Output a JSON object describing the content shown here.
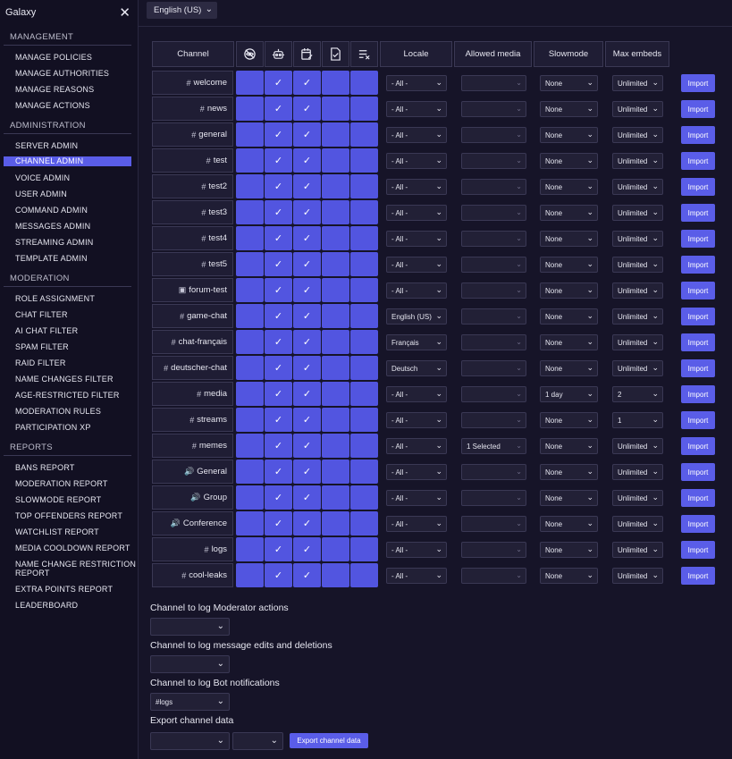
{
  "app": {
    "title": "Galaxy",
    "close_icon": "close-icon"
  },
  "language": {
    "selected": "English (US)"
  },
  "sidebar": {
    "sections": [
      {
        "title": "MANAGEMENT",
        "items": [
          "MANAGE POLICIES",
          "MANAGE AUTHORITIES",
          "MANAGE REASONS",
          "MANAGE ACTIONS"
        ]
      },
      {
        "title": "ADMINISTRATION",
        "items": [
          "SERVER ADMIN",
          "CHANNEL ADMIN",
          "VOICE ADMIN",
          "USER ADMIN",
          "COMMAND ADMIN",
          "MESSAGES ADMIN",
          "STREAMING ADMIN",
          "TEMPLATE ADMIN"
        ]
      },
      {
        "title": "MODERATION",
        "items": [
          "ROLE ASSIGNMENT",
          "CHAT FILTER",
          "AI CHAT FILTER",
          "SPAM FILTER",
          "RAID FILTER",
          "NAME CHANGES FILTER",
          "AGE-RESTRICTED FILTER",
          "MODERATION RULES",
          "PARTICIPATION XP"
        ]
      },
      {
        "title": "REPORTS",
        "items": [
          "BANS REPORT",
          "MODERATION REPORT",
          "SLOWMODE REPORT",
          "TOP OFFENDERS REPORT",
          "WATCHLIST REPORT",
          "MEDIA COOLDOWN REPORT",
          "NAME CHANGE RESTRICTION REPORT",
          "EXTRA POINTS REPORT",
          "LEADERBOARD"
        ]
      }
    ],
    "active": "CHANNEL ADMIN"
  },
  "table": {
    "headers": {
      "channel": "Channel",
      "icons": [
        "eye-slash-icon",
        "bot-icon",
        "calendar-edit-icon",
        "document-check-icon",
        "list-remove-icon"
      ],
      "locale": "Locale",
      "allowed_media": "Allowed media",
      "slowmode": "Slowmode",
      "max_embeds": "Max embeds"
    },
    "import_label": "Import",
    "rows": [
      {
        "icon": "#",
        "name": "welcome",
        "checks": [
          false,
          true,
          true,
          false,
          false
        ],
        "locale": "- All -",
        "media": "",
        "slowmode": "None",
        "max_embeds": "Unlimited"
      },
      {
        "icon": "#",
        "name": "news",
        "checks": [
          false,
          true,
          true,
          false,
          false
        ],
        "locale": "- All -",
        "media": "",
        "slowmode": "None",
        "max_embeds": "Unlimited"
      },
      {
        "icon": "#",
        "name": "general",
        "checks": [
          false,
          true,
          true,
          false,
          false
        ],
        "locale": "- All -",
        "media": "",
        "slowmode": "None",
        "max_embeds": "Unlimited"
      },
      {
        "icon": "#",
        "name": "test",
        "checks": [
          false,
          true,
          true,
          false,
          false
        ],
        "locale": "- All -",
        "media": "",
        "slowmode": "None",
        "max_embeds": "Unlimited"
      },
      {
        "icon": "#",
        "name": "test2",
        "checks": [
          false,
          true,
          true,
          false,
          false
        ],
        "locale": "- All -",
        "media": "",
        "slowmode": "None",
        "max_embeds": "Unlimited"
      },
      {
        "icon": "#",
        "name": "test3",
        "checks": [
          false,
          true,
          true,
          false,
          false
        ],
        "locale": "- All -",
        "media": "",
        "slowmode": "None",
        "max_embeds": "Unlimited"
      },
      {
        "icon": "#",
        "name": "test4",
        "checks": [
          false,
          true,
          true,
          false,
          false
        ],
        "locale": "- All -",
        "media": "",
        "slowmode": "None",
        "max_embeds": "Unlimited"
      },
      {
        "icon": "#",
        "name": "test5",
        "checks": [
          false,
          true,
          true,
          false,
          false
        ],
        "locale": "- All -",
        "media": "",
        "slowmode": "None",
        "max_embeds": "Unlimited"
      },
      {
        "icon": "▣",
        "name": "forum-test",
        "checks": [
          false,
          true,
          true,
          false,
          false
        ],
        "locale": "- All -",
        "media": "",
        "slowmode": "None",
        "max_embeds": "Unlimited"
      },
      {
        "icon": "#",
        "name": "game-chat",
        "checks": [
          false,
          true,
          true,
          false,
          false
        ],
        "locale": "English (US)",
        "media": "",
        "slowmode": "None",
        "max_embeds": "Unlimited"
      },
      {
        "icon": "#",
        "name": "chat-français",
        "checks": [
          false,
          true,
          true,
          false,
          false
        ],
        "locale": "Français",
        "media": "",
        "slowmode": "None",
        "max_embeds": "Unlimited"
      },
      {
        "icon": "#",
        "name": "deutscher-chat",
        "checks": [
          false,
          true,
          true,
          false,
          false
        ],
        "locale": "Deutsch",
        "media": "",
        "slowmode": "None",
        "max_embeds": "Unlimited"
      },
      {
        "icon": "#",
        "name": "media",
        "checks": [
          false,
          true,
          true,
          false,
          false
        ],
        "locale": "- All -",
        "media": "",
        "slowmode": "1 day",
        "max_embeds": "2"
      },
      {
        "icon": "#",
        "name": "streams",
        "checks": [
          false,
          true,
          true,
          false,
          false
        ],
        "locale": "- All -",
        "media": "",
        "slowmode": "None",
        "max_embeds": "1"
      },
      {
        "icon": "#",
        "name": "memes",
        "checks": [
          false,
          true,
          true,
          false,
          false
        ],
        "locale": "- All -",
        "media": "1 Selected",
        "slowmode": "None",
        "max_embeds": "Unlimited"
      },
      {
        "icon": "🔊",
        "name": "General",
        "checks": [
          false,
          true,
          true,
          false,
          false
        ],
        "locale": "- All -",
        "media": "",
        "slowmode": "None",
        "max_embeds": "Unlimited"
      },
      {
        "icon": "🔊",
        "name": "Group",
        "checks": [
          false,
          true,
          true,
          false,
          false
        ],
        "locale": "- All -",
        "media": "",
        "slowmode": "None",
        "max_embeds": "Unlimited"
      },
      {
        "icon": "🔊",
        "name": "Conference",
        "checks": [
          false,
          true,
          true,
          false,
          false
        ],
        "locale": "- All -",
        "media": "",
        "slowmode": "None",
        "max_embeds": "Unlimited"
      },
      {
        "icon": "#",
        "name": "logs",
        "checks": [
          false,
          true,
          true,
          false,
          false
        ],
        "locale": "- All -",
        "media": "",
        "slowmode": "None",
        "max_embeds": "Unlimited"
      },
      {
        "icon": "#",
        "name": "cool-leaks",
        "checks": [
          false,
          true,
          true,
          false,
          false
        ],
        "locale": "- All -",
        "media": "",
        "slowmode": "None",
        "max_embeds": "Unlimited"
      }
    ]
  },
  "settings": {
    "mod_actions_label": "Channel to log Moderator actions",
    "mod_actions_value": "",
    "edits_label": "Channel to log message edits and deletions",
    "edits_value": "",
    "bot_notif_label": "Channel to log Bot notifications",
    "bot_notif_value": "#logs",
    "export_label": "Export channel data",
    "export_value_1": "",
    "export_value_2": "",
    "export_button": "Export channel data"
  }
}
